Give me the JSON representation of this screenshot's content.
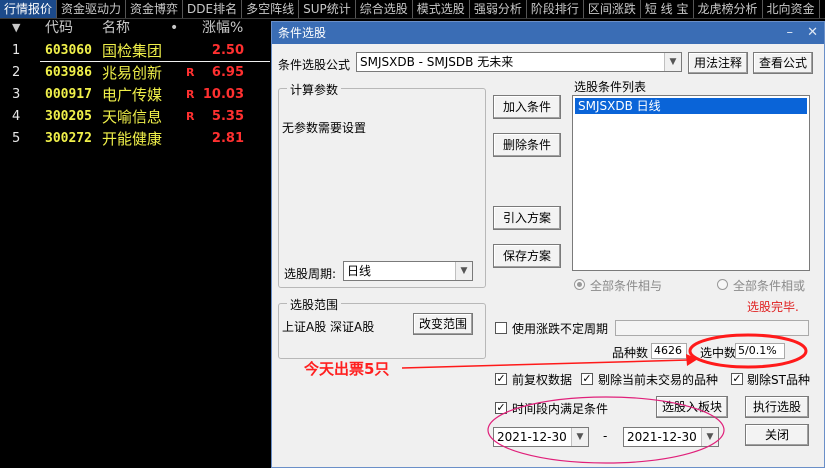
{
  "tabs": [
    "行情报价",
    "资金驱动力",
    "资金博弈",
    "DDE排名",
    "多空阵线",
    "SUP统计",
    "综合选股",
    "模式选股",
    "强弱分析",
    "阶段排行",
    "区间涨跌",
    "短 线 宝",
    "龙虎榜分析",
    "北向资金"
  ],
  "stock_header": {
    "arrow": "▼",
    "code": "代码",
    "name": "名称",
    "dot": "•",
    "pct": "涨幅%"
  },
  "stocks": [
    {
      "idx": "1",
      "code": "603060",
      "name": "国检集团",
      "flag": "",
      "pct": "2.50"
    },
    {
      "idx": "2",
      "code": "603986",
      "name": "兆易创新",
      "flag": "R",
      "pct": "6.95"
    },
    {
      "idx": "3",
      "code": "000917",
      "name": "电广传媒",
      "flag": "R",
      "pct": "10.03"
    },
    {
      "idx": "4",
      "code": "300205",
      "name": "天喻信息",
      "flag": "R",
      "pct": "5.35"
    },
    {
      "idx": "5",
      "code": "300272",
      "name": "开能健康",
      "flag": "",
      "pct": "2.81"
    }
  ],
  "dialog": {
    "title": "条件选股",
    "minimize": "–",
    "close": "✕",
    "formula_label": "条件选股公式",
    "formula_value": "SMJSXDB      - SMJSDB 无未来",
    "usage_button": "用法注释",
    "view_button": "查看公式",
    "calc_group": "计算参数",
    "no_params": "无参数需要设置",
    "add_button": "加入条件",
    "delete_button": "删除条件",
    "import_button": "引入方案",
    "save_button": "保存方案",
    "list_label": "选股条件列表",
    "list_item": "SMJSXDB  日线",
    "period_label": "选股周期:",
    "period_value": "日线",
    "radio_and": "全部条件相与",
    "radio_or": "全部条件相或",
    "status": "选股完毕.",
    "range_group": "选股范围",
    "range_value": "上证A股 深证A股",
    "change_range_button": "改变范围",
    "use_period_label": "使用涨跌不定周期",
    "count_label": "品种数",
    "count_value": "4626",
    "selected_label": "选中数",
    "selected_value": "5/0.1%",
    "opt_prev_adj": "前复权数据",
    "opt_exclude_untraded": "剔除当前未交易的品种",
    "opt_exclude_st": "剔除ST品种",
    "opt_period_cond": "时间段内满足条件",
    "to_block_button": "选股入板块",
    "run_button": "执行选股",
    "date_start": "2021-12-30",
    "date_sep": "-",
    "date_end": "2021-12-30",
    "close_button": "关闭",
    "check_mark": "✓"
  },
  "annotation": {
    "text": "今天出票5只",
    "color": "#ff2020"
  }
}
